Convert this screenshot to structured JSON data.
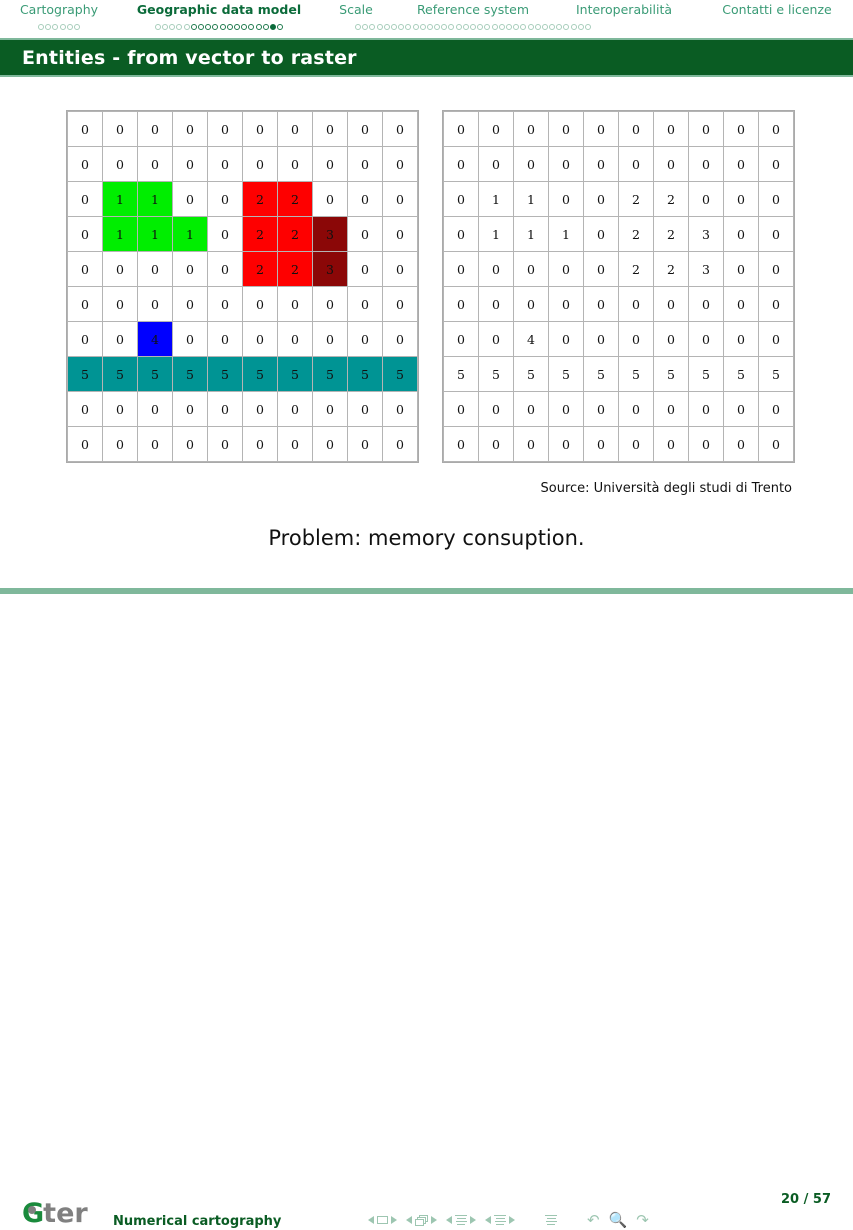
{
  "header": {
    "sections": [
      {
        "label": "Cartography",
        "active": false,
        "dots": {
          "pale": 6,
          "deep": 0,
          "filled_index": -1
        }
      },
      {
        "label": "Geographic data model",
        "active": true,
        "dots": {
          "pale": 5,
          "deep": 13,
          "filled_index": 16
        }
      },
      {
        "label": "Scale",
        "active": false,
        "dots": {
          "pale": 0,
          "deep": 0,
          "filled_index": -1
        }
      },
      {
        "label": "Reference system",
        "active": false,
        "dots": {
          "pale": 33,
          "deep": 0,
          "filled_index": -1
        }
      },
      {
        "label": "Interoperabilità",
        "active": false,
        "dots": {
          "pale": 0,
          "deep": 0,
          "filled_index": -1
        }
      },
      {
        "label": "Contatti e licenze",
        "active": false,
        "dots": {
          "pale": 0,
          "deep": 0,
          "filled_index": -1
        }
      }
    ]
  },
  "slide": {
    "title": "Entities - from vector to raster",
    "source_caption": "Source: Università degli studi di Trento",
    "problem_caption": "Problem: memory consuption."
  },
  "raster": {
    "rows": 10,
    "cols": 10,
    "values": [
      [
        0,
        0,
        0,
        0,
        0,
        0,
        0,
        0,
        0,
        0
      ],
      [
        0,
        0,
        0,
        0,
        0,
        0,
        0,
        0,
        0,
        0
      ],
      [
        0,
        1,
        1,
        0,
        0,
        2,
        2,
        0,
        0,
        0
      ],
      [
        0,
        1,
        1,
        1,
        0,
        2,
        2,
        3,
        0,
        0
      ],
      [
        0,
        0,
        0,
        0,
        0,
        2,
        2,
        3,
        0,
        0
      ],
      [
        0,
        0,
        0,
        0,
        0,
        0,
        0,
        0,
        0,
        0
      ],
      [
        0,
        0,
        4,
        0,
        0,
        0,
        0,
        0,
        0,
        0
      ],
      [
        5,
        5,
        5,
        5,
        5,
        5,
        5,
        5,
        5,
        5
      ],
      [
        0,
        0,
        0,
        0,
        0,
        0,
        0,
        0,
        0,
        0
      ],
      [
        0,
        0,
        0,
        0,
        0,
        0,
        0,
        0,
        0,
        0
      ]
    ],
    "colors": {
      "0": "#ffffff",
      "1": "#00ee00",
      "2": "#fe0000",
      "3": "#8b0707",
      "4": "#0000ff",
      "5": "#009494"
    },
    "left_panel_colored": true,
    "right_panel_colored": false
  },
  "footer": {
    "logo_first": "G",
    "logo_rest": "ter",
    "course": "Numerical cartography",
    "page": "20 / 57"
  },
  "theme": {
    "header_green": "#3a9b76",
    "header_green_active": "#0b6b3a",
    "title_bar_bg": "#0a5c23",
    "title_bar_border": "#7fb89b",
    "footer_rule": "#7fb89b",
    "footer_text": "#0a5c23",
    "nav_symbol": "#9dc6b1",
    "logo_green": "#1a8a3c",
    "logo_gray": "#808080"
  }
}
